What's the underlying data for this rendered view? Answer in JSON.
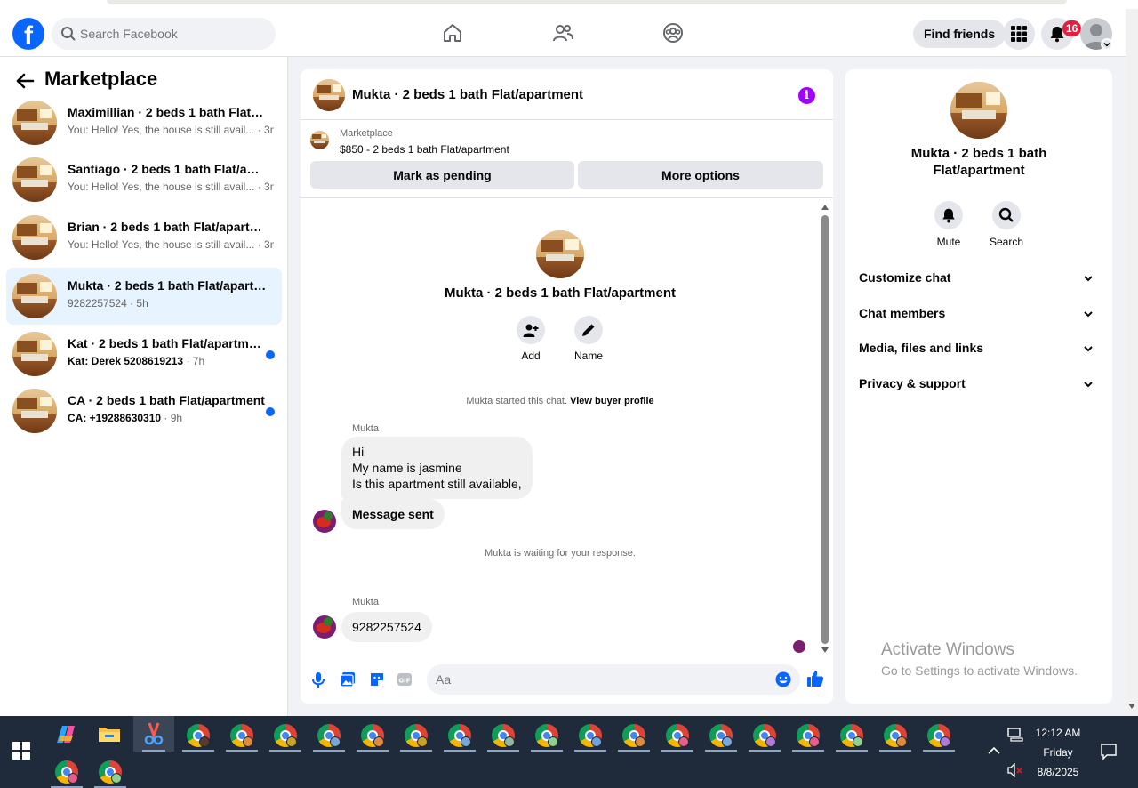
{
  "header": {
    "logo_label": "f",
    "search_placeholder": "Search Facebook",
    "find_friends_label": "Find friends",
    "notification_count": "16"
  },
  "sidebar": {
    "title": "Marketplace",
    "conversations": [
      {
        "title": "Maximillian · 2 beds 1 bath Flat/ap...",
        "preview": "You: Hello! Yes, the house is still avail...",
        "time": " · 3m",
        "unread": false,
        "active": false
      },
      {
        "title": "Santiago · 2 beds 1 bath Flat/apart...",
        "preview": "You: Hello! Yes, the house is still avail...",
        "time": " · 3m",
        "unread": false,
        "active": false
      },
      {
        "title": "Brian · 2 beds 1 bath Flat/apartment",
        "preview": "You: Hello! Yes, the house is still avail...",
        "time": " · 3m",
        "unread": false,
        "active": false
      },
      {
        "title": "Mukta · 2 beds 1 bath Flat/apartm...",
        "preview": "9282257524",
        "time": " · 5h",
        "unread": false,
        "active": true
      },
      {
        "title": "Kat · 2 beds 1 bath Flat/apartment",
        "preview": "Kat: Derek 5208619213",
        "time": " · 7h",
        "unread": true,
        "active": false
      },
      {
        "title": "CA · 2 beds 1 bath Flat/apartment",
        "preview": "CA: +19288630310",
        "time": " · 9h",
        "unread": true,
        "active": false
      }
    ]
  },
  "chat": {
    "title": "Mukta · 2 beds 1 bath Flat/apartment",
    "listing_source": "Marketplace",
    "listing_price": "$850 - 2 beds 1 bath Flat/apartment",
    "mark_pending_label": "Mark as pending",
    "more_options_label": "More options",
    "center_title": "Mukta · 2 beds 1 bath Flat/apartment",
    "add_label": "Add",
    "name_label": "Name",
    "started_text": "Mukta started this chat. ",
    "view_buyer_profile": "View buyer profile",
    "sender_name_1": "Mukta",
    "message_1_line_1": "Hi",
    "message_1_line_2": "My name is jasmine",
    "message_1_line_3": "Is this apartment still available,",
    "message_2": "Message sent",
    "waiting_text": "Mukta is waiting for your response.",
    "sender_name_2": "Mukta",
    "message_3": "9282257524",
    "composer_placeholder": "Aa"
  },
  "right_panel": {
    "title": "Mukta · 2 beds 1 bath Flat/apartment",
    "mute_label": "Mute",
    "search_label": "Search",
    "sections": [
      "Customize chat",
      "Chat members",
      "Media, files and links",
      "Privacy & support"
    ]
  },
  "watermark": {
    "line1": "Activate Windows",
    "line2": "Go to Settings to activate Windows."
  },
  "taskbar": {
    "time": "12:12 AM",
    "day": "Friday",
    "date": "8/8/2025"
  },
  "colors": {
    "facebook_blue": "#0866ff",
    "active_conversation": "#e7f3ff",
    "info_purple": "#a200ff",
    "badge_red": "#e41e3f"
  }
}
